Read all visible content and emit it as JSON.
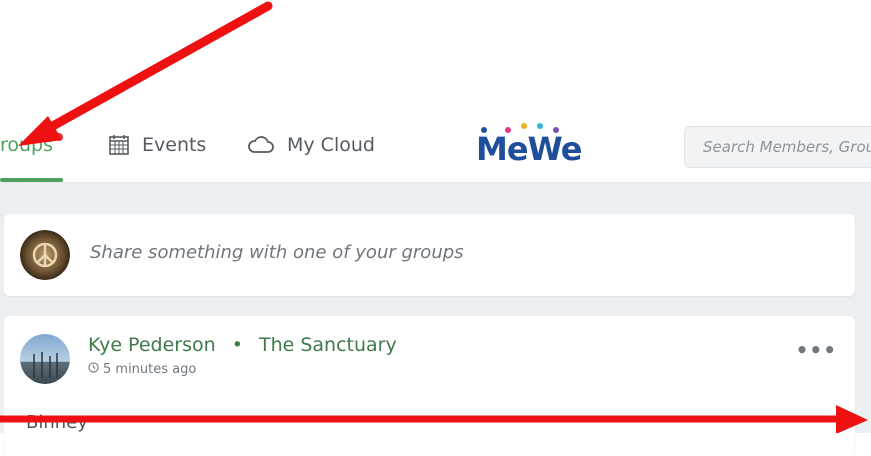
{
  "nav": {
    "groups_label": "roups",
    "events_label": "Events",
    "cloud_label": "My Cloud"
  },
  "logo": {
    "text": "MeWe"
  },
  "search": {
    "placeholder": "Search Members, Grou"
  },
  "share": {
    "prompt": "Share something with one of your groups"
  },
  "post": {
    "author": "Kye Pederson",
    "separator": "•",
    "group": "The Sanctuary",
    "time": "5 minutes ago",
    "more": "•••",
    "body": "Binney"
  },
  "colors": {
    "accent_green": "#4fa160",
    "notification_red": "#e0363e",
    "annotation_red": "#ee1111",
    "logo_blue": "#1f4f9b"
  },
  "icons": [
    "calendar-icon",
    "cloud-icon",
    "clock-icon",
    "more-icon"
  ]
}
